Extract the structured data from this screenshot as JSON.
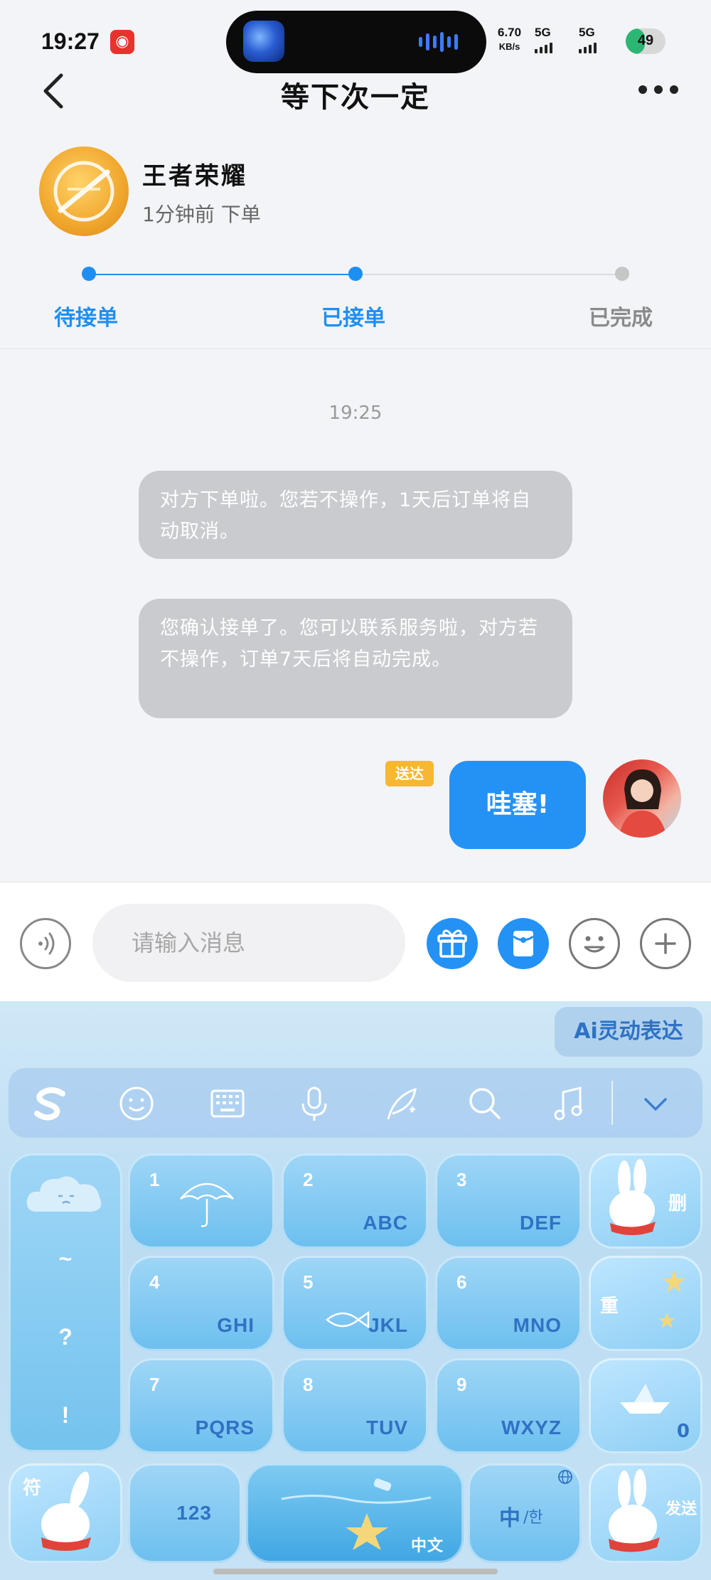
{
  "status_bar": {
    "time": "19:27",
    "net_speed": "6.70",
    "net_unit": "KB/s",
    "signal_1": "5G",
    "signal_2": "5G",
    "battery": "49",
    "battery_level": 0.49
  },
  "header": {
    "title": "等下次一定"
  },
  "game": {
    "name": "王者荣耀",
    "order_time": "1分钟前  下单"
  },
  "progress": {
    "steps": [
      "待接单",
      "已接单",
      "已完成"
    ],
    "current_step": 2
  },
  "chat": {
    "timestamp": "19:25",
    "system_messages": [
      "对方下单啦。您若不操作，1天后订单将自动取消。",
      "您确认接单了。您可以联系服务啦，对方若不操作，订单7天后将自动完成。"
    ],
    "my_message": "哇塞!",
    "delivered_label": "送达"
  },
  "input": {
    "placeholder": "请输入消息"
  },
  "keyboard": {
    "ai_label": "Ai灵动表达",
    "keys": [
      {
        "num": "1",
        "letters": ""
      },
      {
        "num": "2",
        "letters": "ABC"
      },
      {
        "num": "3",
        "letters": "DEF"
      },
      {
        "num": "4",
        "letters": "GHI"
      },
      {
        "num": "5",
        "letters": "JKL"
      },
      {
        "num": "6",
        "letters": "MNO"
      },
      {
        "num": "7",
        "letters": "PQRS"
      },
      {
        "num": "8",
        "letters": "TUV"
      },
      {
        "num": "9",
        "letters": "WXYZ"
      }
    ],
    "side_keys": [
      "~",
      "?",
      "!"
    ],
    "delete_label": "删",
    "redo_label": "重",
    "zero_label": "0",
    "symbol_label": "符",
    "numbers_label": "123",
    "space_label": "中文",
    "lang_main": "中",
    "lang_alt": "/한",
    "send_label": "发送"
  }
}
